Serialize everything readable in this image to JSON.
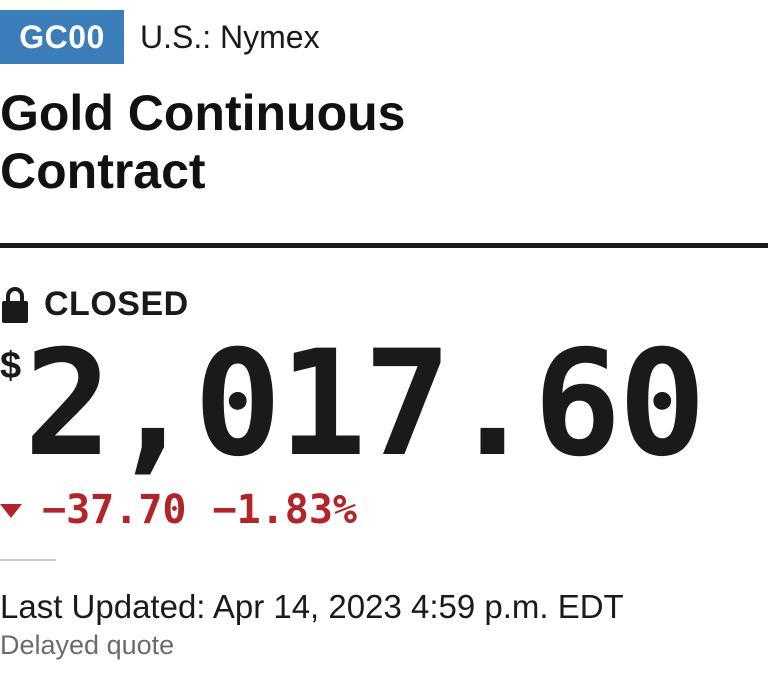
{
  "quote": {
    "symbol": "GC00",
    "exchange": "U.S.: Nymex",
    "name": "Gold Continuous Contract",
    "status": "CLOSED",
    "currency_symbol": "$",
    "price": "2,017.60",
    "change": "−37.70",
    "change_percent": "−1.83%",
    "direction": "down",
    "last_updated": "Last Updated: Apr 14, 2023 4:59 p.m. EDT",
    "delay_note": "Delayed quote"
  },
  "icons": {
    "status": "lock-icon",
    "direction": "triangle-down-icon"
  },
  "colors": {
    "badge_bg": "#3b7db8",
    "negative": "#b3232a",
    "text": "#1a1a1a",
    "muted": "#6b6b6b"
  }
}
